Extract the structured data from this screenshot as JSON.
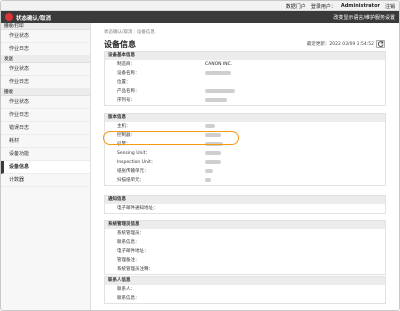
{
  "topbar": {
    "portal": "数据门户",
    "login_label": "登录用户：",
    "user": "Administrator",
    "logout": "注销",
    "lang": "改变显示语言/维护服务设置"
  },
  "header": {
    "title": "状态确认/取消"
  },
  "sidebar": {
    "sections": [
      {
        "title": "接收/打印",
        "items": [
          "作业状态",
          "作业日志"
        ]
      },
      {
        "title": "发送",
        "items": [
          "作业状态",
          "作业日志"
        ]
      },
      {
        "title": "接收",
        "items": [
          "作业状态",
          "作业日志",
          "错误日志"
        ]
      }
    ],
    "items_extra": [
      "耗材",
      "设备功能",
      "设备信息",
      "计数器"
    ],
    "active": "设备信息"
  },
  "main": {
    "breadcrumb": "状态确认/取消 : 设备信息",
    "title": "设备信息",
    "updated_label": "最近更新：2022 03/09 1:54:52",
    "panels": [
      {
        "title": "设备基本信息",
        "rows": [
          {
            "label": "制造商：",
            "value": "CANON INC."
          },
          {
            "label": "设备名称：",
            "value": ""
          },
          {
            "label": "位置：",
            "value": ""
          },
          {
            "label": "产品名称：",
            "value": ""
          },
          {
            "label": "序列号：",
            "value": ""
          }
        ]
      },
      {
        "title": "版本信息",
        "rows": [
          {
            "label": "主机：",
            "value": ""
          },
          {
            "label": "控制器：",
            "value": ""
          },
          {
            "label": "引擎：",
            "value": ""
          },
          {
            "label": "Sensing Unit：",
            "value": ""
          },
          {
            "label": "Inspection Unit：",
            "value": ""
          },
          {
            "label": "纸张传输单元：",
            "value": ""
          },
          {
            "label": "扫描纸单元：",
            "value": ""
          }
        ]
      },
      {
        "title": "通知信息",
        "rows": [
          {
            "label": "电子邮件通知地址：",
            "value": ""
          }
        ]
      },
      {
        "title": "系统管理员信息",
        "rows": [
          {
            "label": "系统管理员：",
            "value": ""
          },
          {
            "label": "联系信息：",
            "value": ""
          },
          {
            "label": "电子邮件地址：",
            "value": ""
          },
          {
            "label": "管理备注：",
            "value": ""
          },
          {
            "label": "系统管理员注释：",
            "value": ""
          }
        ]
      },
      {
        "title": "联系人信息",
        "rows": [
          {
            "label": "联系人：",
            "value": ""
          },
          {
            "label": "联系信息：",
            "value": ""
          }
        ]
      }
    ]
  },
  "colors": {
    "header_bg": "#3a3a3a",
    "highlight": "#f39c12",
    "logo": "#dd3333"
  },
  "icons": {
    "logo": "brand-logo-icon",
    "refresh": "refresh-icon"
  }
}
